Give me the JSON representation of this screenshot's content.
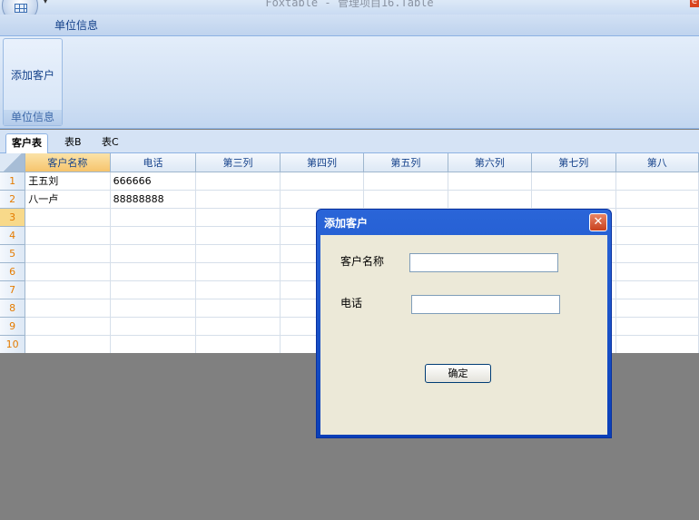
{
  "window": {
    "title": "Foxtable - 管理项目16.Table",
    "qat_arrow": "▾",
    "close_glyph": "e"
  },
  "ribbon": {
    "active_tab": "单位信息",
    "group_label": "单位信息",
    "add_customer_label": "添加客户"
  },
  "sheet_tabs": [
    "客户表",
    "表B",
    "表C"
  ],
  "grid": {
    "columns": [
      "客户名称",
      "电话",
      "第三列",
      "第四列",
      "第五列",
      "第六列",
      "第七列",
      "第八"
    ],
    "rows": [
      {
        "num": "1",
        "name": "王五刘",
        "phone": "666666"
      },
      {
        "num": "2",
        "name": "八一卢",
        "phone": "88888888"
      },
      {
        "num": "3",
        "name": "",
        "phone": ""
      },
      {
        "num": "4",
        "name": "",
        "phone": ""
      },
      {
        "num": "5",
        "name": "",
        "phone": ""
      },
      {
        "num": "6",
        "name": "",
        "phone": ""
      },
      {
        "num": "7",
        "name": "",
        "phone": ""
      },
      {
        "num": "8",
        "name": "",
        "phone": ""
      },
      {
        "num": "9",
        "name": "",
        "phone": ""
      },
      {
        "num": "10",
        "name": "",
        "phone": ""
      }
    ],
    "current_row": 3
  },
  "dialog": {
    "title": "添加客户",
    "close_glyph": "✕",
    "name_label": "客户名称",
    "name_value": "",
    "phone_label": "电话",
    "phone_value": "",
    "ok_label": "确定"
  }
}
